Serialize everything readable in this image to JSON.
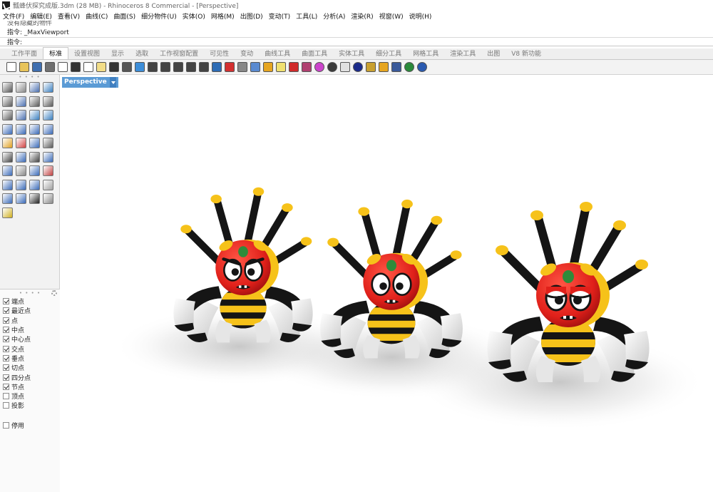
{
  "window": {
    "title": "瓢蜂伏探究成版.3dm (28 MB) - Rhinoceros 8 Commercial - [Perspective]"
  },
  "menu": [
    "文件(F)",
    "编辑(E)",
    "查看(V)",
    "曲线(C)",
    "曲面(S)",
    "细分物件(U)",
    "实体(O)",
    "网格(M)",
    "出图(D)",
    "变动(T)",
    "工具(L)",
    "分析(A)",
    "渲染(R)",
    "视窗(W)",
    "说明(H)"
  ],
  "command": {
    "history_partial": "没有隐藏的物件",
    "last": "指令: _MaxViewport",
    "prompt": "指令:"
  },
  "tabs": {
    "items": [
      "工作平面",
      "标准",
      "设置视图",
      "显示",
      "选取",
      "工作视窗配置",
      "可见性",
      "变动",
      "曲线工具",
      "曲面工具",
      "实体工具",
      "细分工具",
      "网格工具",
      "渲染工具",
      "出图",
      "V8 新功能"
    ],
    "active": "标准"
  },
  "toolbar_icons": [
    "new-icon",
    "open-icon",
    "save-icon",
    "print-icon",
    "import-icon",
    "cut-icon",
    "copy-icon",
    "paste-icon",
    "undo-icon",
    "pan-icon",
    "rotate-view-icon",
    "zoom-icon",
    "zoom-window-icon",
    "zoom-extents-icon",
    "zoom-selected-icon",
    "undo-view-icon",
    "four-views-icon",
    "car-icon",
    "ellipse-view-icon",
    "cplane-icon",
    "snap-settings-icon",
    "light-icon",
    "shade-icon",
    "material-icon",
    "color-wheel-icon",
    "render-sphere-icon",
    "render-icon",
    "globe-icon",
    "options-icon",
    "gear-icon",
    "osnap-toggle-icon",
    "viewport-globe-icon",
    "help-icon"
  ],
  "left_tools": [
    "select-icon",
    "point-icon",
    "polyline-icon",
    "curve-icon",
    "circle-icon",
    "ellipse-icon",
    "arc-icon",
    "rectangle-icon",
    "polygon-icon",
    "fillet-curve-icon",
    "offset-icon",
    "surface-icon",
    "box-icon",
    "sphere-icon",
    "cylinder-icon",
    "extrude-icon",
    "boolean-icon",
    "explode-icon",
    "trim-icon",
    "split-icon",
    "group-icon",
    "join-icon",
    "move-icon",
    "mirror-icon",
    "text-icon",
    "dimension-icon",
    "array-icon",
    "scale-icon",
    "mesh-icon",
    "hatch-icon",
    "grid-array-icon",
    "transform-icon",
    "analyze-icon",
    "block-icon",
    "check-icon",
    "cage-icon",
    "paint-icon"
  ],
  "osnap": {
    "items": [
      {
        "label": "端点",
        "checked": true
      },
      {
        "label": "最近点",
        "checked": true
      },
      {
        "label": "点",
        "checked": true
      },
      {
        "label": "中点",
        "checked": true
      },
      {
        "label": "中心点",
        "checked": true
      },
      {
        "label": "交点",
        "checked": true
      },
      {
        "label": "垂点",
        "checked": true
      },
      {
        "label": "切点",
        "checked": true
      },
      {
        "label": "四分点",
        "checked": true
      },
      {
        "label": "节点",
        "checked": true
      },
      {
        "label": "顶点",
        "checked": false
      },
      {
        "label": "投影",
        "checked": false
      }
    ],
    "disable": {
      "label": "停用",
      "checked": false
    }
  },
  "viewport": {
    "label": "Perspective"
  },
  "colors": {
    "viewport_tab": "#5b9bd5",
    "character_red": "#e8231e",
    "character_yellow": "#f6c21a",
    "character_black": "#141414"
  }
}
